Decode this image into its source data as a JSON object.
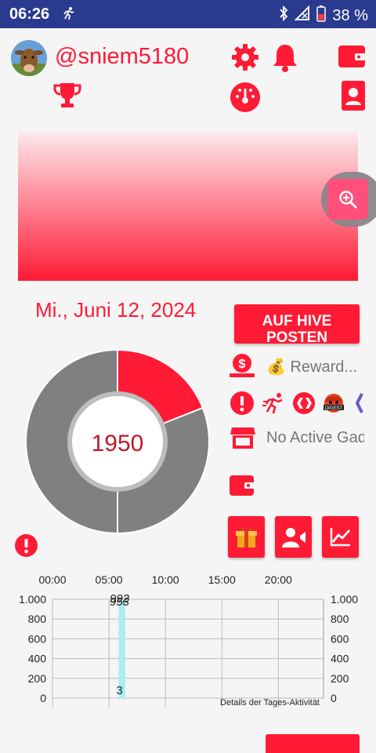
{
  "status_bar": {
    "time": "06:26",
    "battery": "38 %"
  },
  "profile": {
    "username": "@sniem5180"
  },
  "date": "Mi., Juni 12, 2024",
  "post_button": {
    "label": "AUF HIVE POSTEN"
  },
  "rewards": {
    "text": "💰 Reward..."
  },
  "gadgets": {
    "text": "No Active Gad"
  },
  "donut": {
    "center_value": "1950",
    "segments": [
      {
        "fraction": 0.19,
        "color": "#ff1a35"
      },
      {
        "fraction": 0.81,
        "color": "#808080"
      }
    ]
  },
  "colors": {
    "accent": "#ff1a35",
    "status_bar": "#2a3a8f",
    "bar": "#a6eef2"
  },
  "chart_data": {
    "type": "bar",
    "x_ticks": [
      "00:00",
      "05:00",
      "10:00",
      "15:00",
      "20:00"
    ],
    "y_ticks_left": [
      "0",
      "200",
      "400",
      "600",
      "800",
      "1.000"
    ],
    "y_ticks_right": [
      "0",
      "200",
      "400",
      "600",
      "800",
      "1.000"
    ],
    "ylim": [
      0,
      1000
    ],
    "xlim": [
      0,
      24
    ],
    "grid": true,
    "bars": [
      {
        "x": 6.0,
        "value": 953,
        "label": "953"
      },
      {
        "x": 6.3,
        "value": 992,
        "label": "992"
      },
      {
        "x": 5.8,
        "value": 3,
        "label": "3"
      }
    ],
    "description_label": "Details der Tages-Aktivität"
  }
}
